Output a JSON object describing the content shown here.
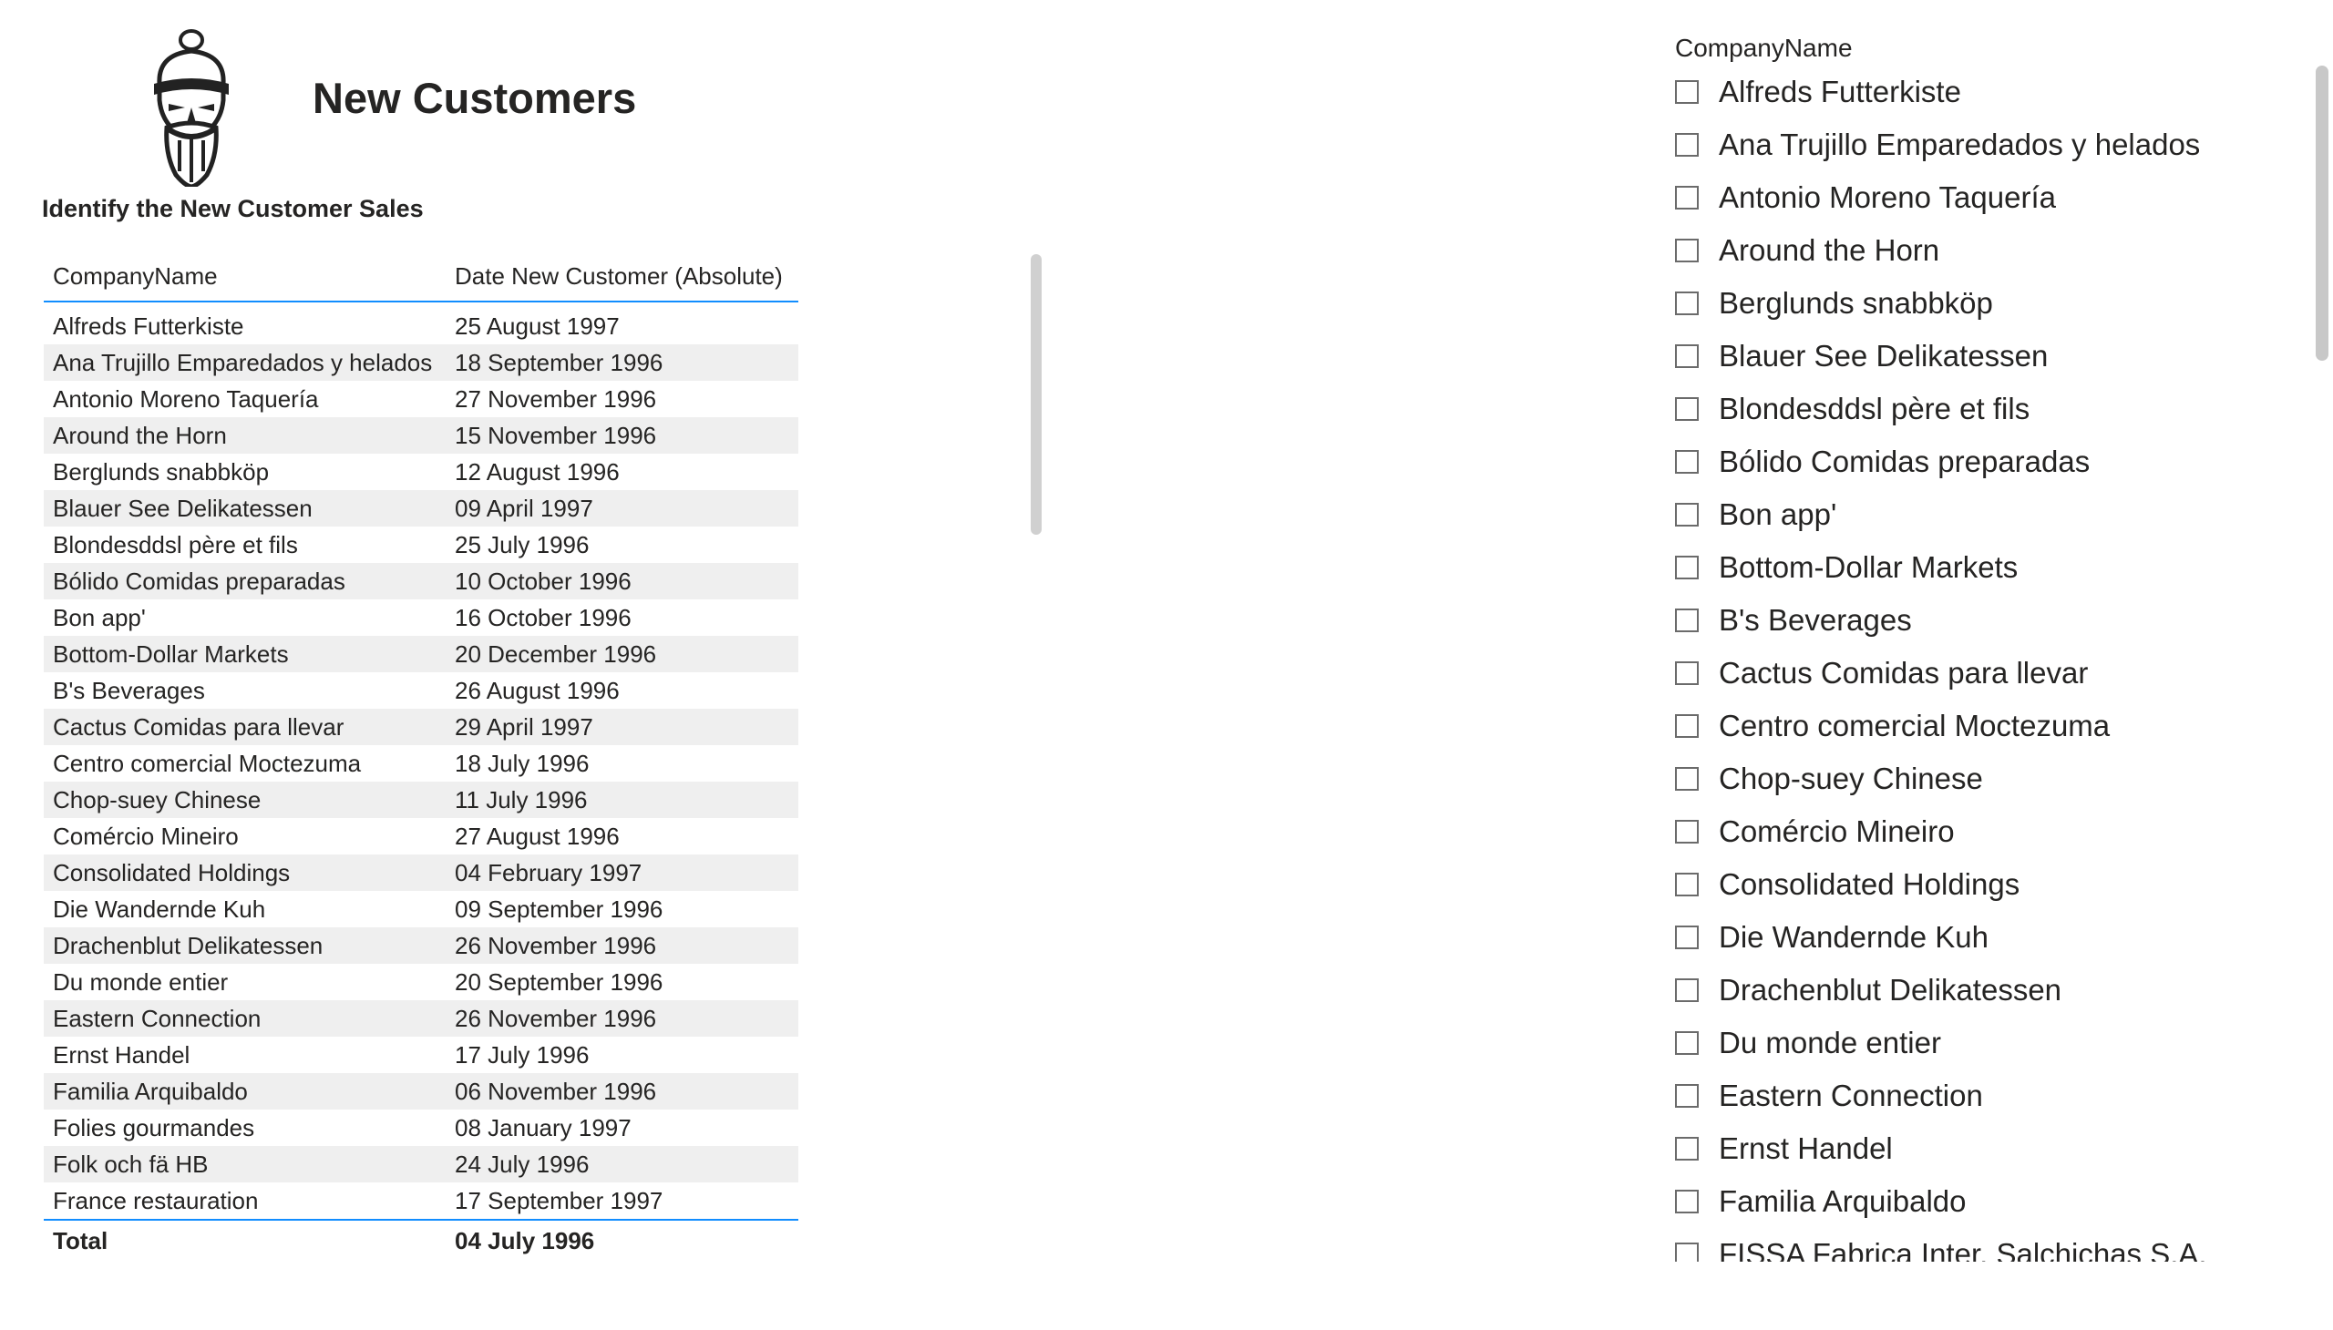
{
  "report": {
    "title": "New Customers",
    "subtitle": "Identify the New Customer Sales"
  },
  "table": {
    "columns": [
      "CompanyName",
      "Date New Customer (Absolute)"
    ],
    "rows": [
      [
        "Alfreds Futterkiste",
        "25 August 1997"
      ],
      [
        "Ana Trujillo Emparedados y helados",
        "18 September 1996"
      ],
      [
        "Antonio Moreno Taquería",
        "27 November 1996"
      ],
      [
        "Around the Horn",
        "15 November 1996"
      ],
      [
        "Berglunds snabbköp",
        "12 August 1996"
      ],
      [
        "Blauer See Delikatessen",
        "09 April 1997"
      ],
      [
        "Blondesddsl père et fils",
        "25 July 1996"
      ],
      [
        "Bólido Comidas preparadas",
        "10 October 1996"
      ],
      [
        "Bon app'",
        "16 October 1996"
      ],
      [
        "Bottom-Dollar Markets",
        "20 December 1996"
      ],
      [
        "B's Beverages",
        "26 August 1996"
      ],
      [
        "Cactus Comidas para llevar",
        "29 April 1997"
      ],
      [
        "Centro comercial Moctezuma",
        "18 July 1996"
      ],
      [
        "Chop-suey Chinese",
        "11 July 1996"
      ],
      [
        "Comércio Mineiro",
        "27 August 1996"
      ],
      [
        "Consolidated Holdings",
        "04 February 1997"
      ],
      [
        "Die Wandernde Kuh",
        "09 September 1996"
      ],
      [
        "Drachenblut Delikatessen",
        "26 November 1996"
      ],
      [
        "Du monde entier",
        "20 September 1996"
      ],
      [
        "Eastern Connection",
        "26 November 1996"
      ],
      [
        "Ernst Handel",
        "17 July 1996"
      ],
      [
        "Familia Arquibaldo",
        "06 November 1996"
      ],
      [
        "Folies gourmandes",
        "08 January 1997"
      ],
      [
        "Folk och fä HB",
        "24 July 1996"
      ],
      [
        "France restauration",
        "17 September 1997"
      ]
    ],
    "total": {
      "label": "Total",
      "value": "04 July 1996"
    }
  },
  "slicer": {
    "header": "CompanyName",
    "items": [
      "Alfreds Futterkiste",
      "Ana Trujillo Emparedados y helados",
      "Antonio Moreno Taquería",
      "Around the Horn",
      "Berglunds snabbköp",
      "Blauer See Delikatessen",
      "Blondesddsl père et fils",
      "Bólido Comidas preparadas",
      "Bon app'",
      "Bottom-Dollar Markets",
      "B's Beverages",
      "Cactus Comidas para llevar",
      "Centro comercial Moctezuma",
      "Chop-suey Chinese",
      "Comércio Mineiro",
      "Consolidated Holdings",
      "Die Wandernde Kuh",
      "Drachenblut Delikatessen",
      "Du monde entier",
      "Eastern Connection",
      "Ernst Handel",
      "Familia Arquibaldo",
      "FISSA Fabrica Inter. Salchichas S.A."
    ]
  },
  "colors": {
    "accent": "#118DFF",
    "row_alt": "#EFEFEF",
    "text": "#252423"
  }
}
